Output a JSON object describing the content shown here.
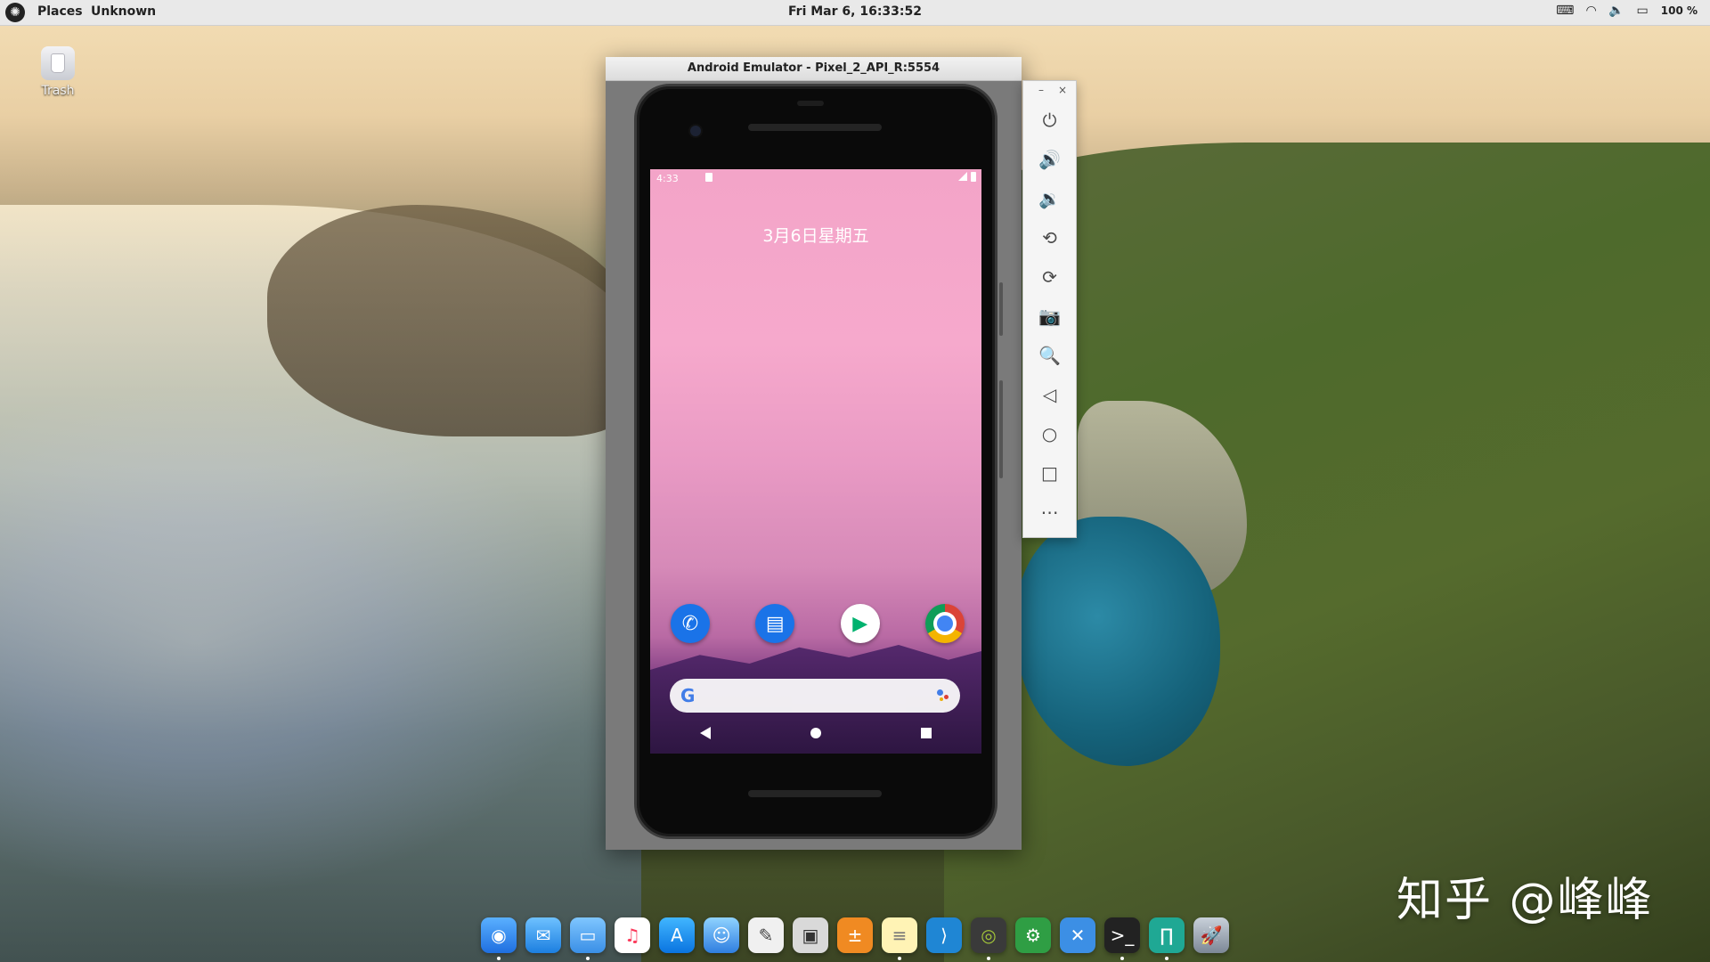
{
  "topbar": {
    "places": "Places",
    "app": "Unknown",
    "clock": "Fri Mar  6, 16:33:52",
    "battery": "100 %"
  },
  "desktop": {
    "trash_label": "Trash"
  },
  "emulator": {
    "title": "Android Emulator - Pixel_2_API_R:5554",
    "status_time": "4:33",
    "date": "3月6日星期五"
  },
  "toolbar": {
    "minimize": "–",
    "close": "×",
    "buttons": [
      "⏻",
      "🔊",
      "🔉",
      "⟲",
      "⟳",
      "📷",
      "🔍",
      "◁",
      "○",
      "□",
      "⋯"
    ]
  },
  "watermark": "知乎 @峰峰",
  "dock_apps": [
    "safari",
    "mail",
    "files",
    "music",
    "app-store",
    "finder",
    "accessories",
    "screenshot",
    "calculator",
    "notes",
    "vscode",
    "android-studio",
    "settings",
    "xcode",
    "terminal",
    "gitkraken",
    "launchpad"
  ],
  "colors": {
    "accent_blue": "#1a73e8",
    "wallpaper_pink": "#f3a4c8"
  }
}
